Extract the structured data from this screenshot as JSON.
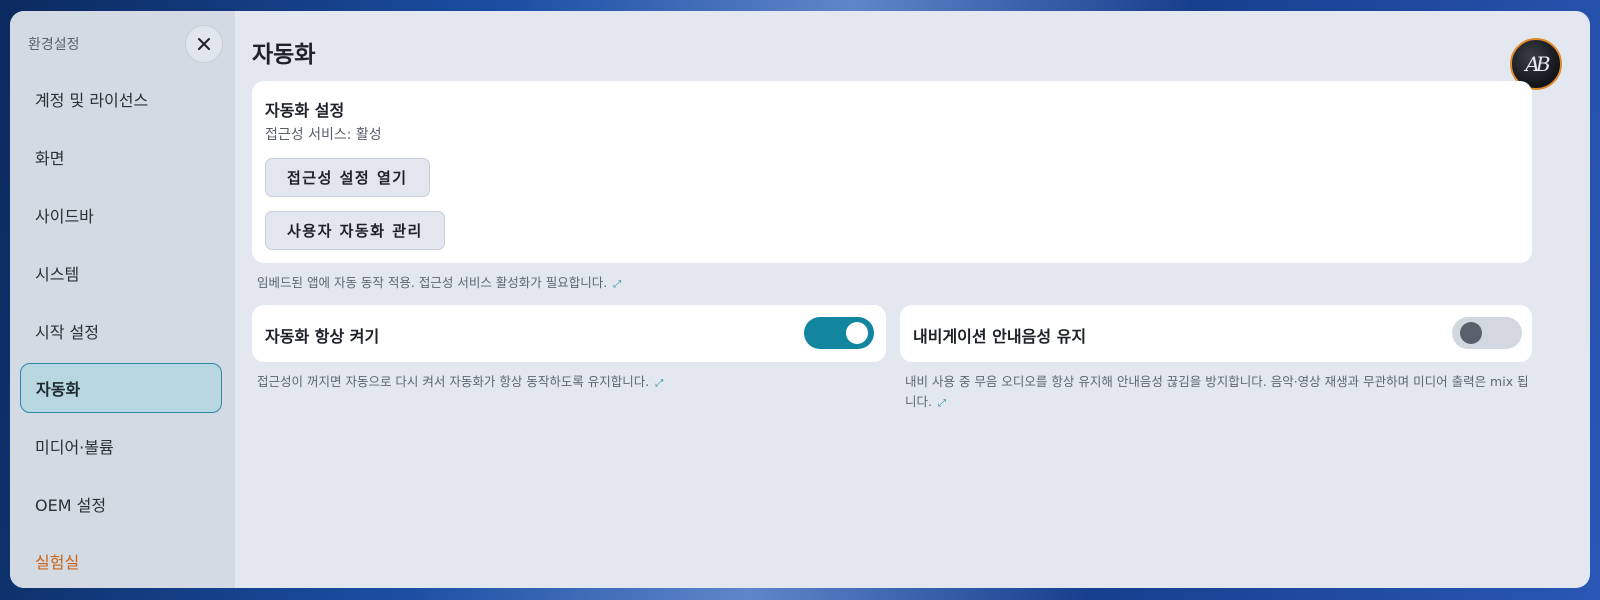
{
  "sidebar": {
    "title": "환경설정",
    "items": [
      {
        "label": "계정 및 라이선스"
      },
      {
        "label": "화면"
      },
      {
        "label": "사이드바"
      },
      {
        "label": "시스템"
      },
      {
        "label": "시작 설정"
      },
      {
        "label": "자동화"
      },
      {
        "label": "미디어·볼륨"
      },
      {
        "label": "OEM 설정"
      },
      {
        "label": "실험실"
      }
    ],
    "active_index": 5
  },
  "main": {
    "title": "자동화",
    "avatar_text": "AB",
    "automation_card": {
      "title": "자동화 설정",
      "status": "접근성 서비스: 활성",
      "open_accessibility_label": "접근성 설정 열기",
      "manage_automation_label": "사용자 자동화 관리",
      "hint": "임베드된 앱에 자동 동작 적용. 접근성 서비스 활성화가 필요합니다."
    },
    "always_on": {
      "label": "자동화 항상 켜기",
      "enabled": true,
      "hint": "접근성이 꺼지면 자동으로 다시 켜서 자동화가 항상 동작하도록 유지합니다."
    },
    "nav_voice": {
      "label": "내비게이션 안내음성 유지",
      "enabled": false,
      "hint": "내비 사용 중 무음 오디오를 항상 유지해 안내음성 끊김을 방지합니다. 음악·영상 재생과 무관하며 미디어 출력은 mix 됩니다."
    },
    "link_glyph": "⤢"
  },
  "colors": {
    "accent": "#12869e",
    "active_nav_bg": "#b9d7e0",
    "lab_orange": "#c8651a"
  }
}
